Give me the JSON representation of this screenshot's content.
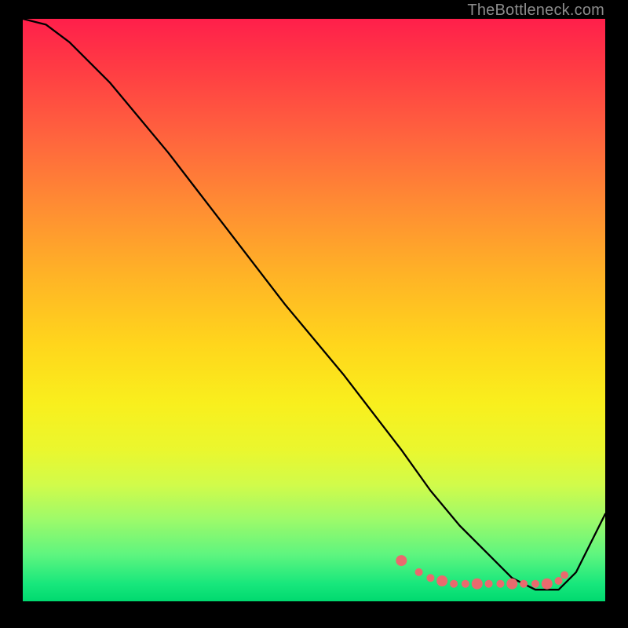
{
  "watermark": "TheBottleneck.com",
  "colors": {
    "background": "#000000",
    "gradient_top": "#ff1f4b",
    "gradient_bottom": "#00d96f",
    "line": "#000000",
    "dots": "#e96a6e",
    "watermark": "#8b8b8b"
  },
  "chart_data": {
    "type": "line",
    "title": "",
    "xlabel": "",
    "ylabel": "",
    "xlim": [
      0,
      100
    ],
    "ylim": [
      0,
      100
    ],
    "x": [
      0,
      4,
      8,
      15,
      25,
      35,
      45,
      55,
      65,
      70,
      75,
      80,
      84,
      88,
      92,
      95,
      100
    ],
    "values": [
      100,
      99,
      96,
      89,
      77,
      64,
      51,
      39,
      26,
      19,
      13,
      8,
      4,
      2,
      2,
      5,
      15
    ],
    "markers": {
      "note": "dotted band near the valley",
      "x": [
        65,
        68,
        70,
        72,
        74,
        76,
        78,
        80,
        82,
        84,
        86,
        88,
        90,
        92,
        93
      ],
      "y": [
        7,
        5,
        4,
        3.5,
        3,
        3,
        3,
        3,
        3,
        3,
        3,
        3,
        3,
        3.5,
        4.5
      ]
    }
  }
}
